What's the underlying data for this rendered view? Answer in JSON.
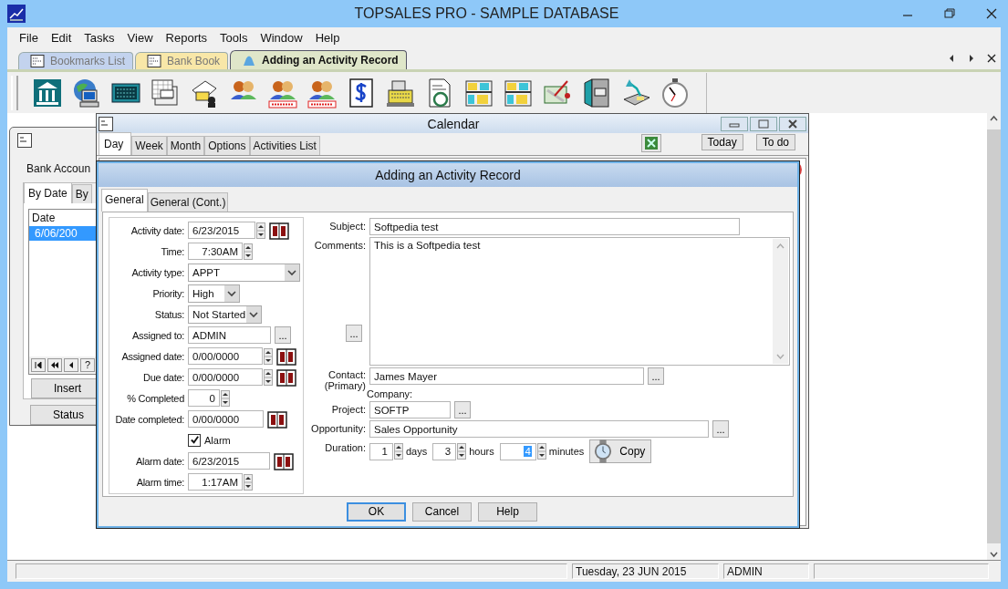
{
  "window": {
    "title": "TOPSALES PRO - SAMPLE DATABASE"
  },
  "menu": [
    "File",
    "Edit",
    "Tasks",
    "View",
    "Reports",
    "Tools",
    "Window",
    "Help"
  ],
  "document_tabs": [
    {
      "label": "Bookmarks List",
      "selected": false,
      "color": "#c3d3ee"
    },
    {
      "label": "Bank Book",
      "selected": false,
      "color": "#f8e7a8"
    },
    {
      "label": "Adding an Activity Record",
      "selected": true,
      "color": "#dfe6c9"
    }
  ],
  "bank_account_window": {
    "heading": "Bank Accoun",
    "tabs": [
      {
        "label": "By Date",
        "selected": true
      },
      {
        "label": "By",
        "selected": false
      }
    ],
    "list": {
      "column": "Date",
      "rows": [
        {
          "value": "6/06/200",
          "selected": true
        }
      ]
    },
    "nav_help": "?",
    "buttons": [
      "Insert",
      "Status"
    ]
  },
  "calendar_window": {
    "title": "Calendar",
    "tabs": [
      {
        "label": "Day",
        "selected": true
      },
      {
        "label": "Week",
        "selected": false
      },
      {
        "label": "Month",
        "selected": false
      },
      {
        "label": "Options",
        "selected": false
      },
      {
        "label": "Activities List",
        "selected": false
      }
    ],
    "buttons": [
      "Today",
      "To do"
    ]
  },
  "dialog": {
    "title": "Adding an Activity Record",
    "tabs": [
      {
        "label": "General",
        "selected": true
      },
      {
        "label": "General (Cont.)",
        "selected": false
      }
    ],
    "left_fields": [
      {
        "label": "Activity date:",
        "value": "6/23/2015",
        "kind": "date-spin"
      },
      {
        "label": "Time:",
        "value": "7:30AM",
        "kind": "spin"
      },
      {
        "label": "Activity type:",
        "value": "APPT",
        "kind": "combo"
      },
      {
        "label": "Priority:",
        "value": "High",
        "kind": "combo"
      },
      {
        "label": "Status:",
        "value": "Not Started",
        "kind": "combo"
      },
      {
        "label": "Assigned to:",
        "value": "ADMIN",
        "kind": "lookup",
        "button": "..."
      },
      {
        "label": "Assigned date:",
        "value": "0/00/0000",
        "kind": "date-spin"
      },
      {
        "label": "Due date:",
        "value": "0/00/0000",
        "kind": "date-spin"
      },
      {
        "label": "% Completed",
        "value": "0",
        "kind": "spin"
      },
      {
        "label": "Date completed:",
        "value": "0/00/0000",
        "kind": "date"
      },
      {
        "label": "Alarm",
        "kind": "checkbox",
        "checked": true
      },
      {
        "label": "Alarm date:",
        "value": "6/23/2015",
        "kind": "date"
      },
      {
        "label": "Alarm time:",
        "value": "1:17AM",
        "kind": "spin"
      }
    ],
    "subject": {
      "label": "Subject:",
      "value": "Softpedia test"
    },
    "comments": {
      "label": "Comments:",
      "value": "This is a Softpedia test",
      "button": "..."
    },
    "contact": {
      "label": "Contact:",
      "sublabel": "(Primary)",
      "value": "James Mayer",
      "button": "..."
    },
    "company": {
      "label": "Company:"
    },
    "project": {
      "label": "Project:",
      "value": "SOFTP",
      "button": "..."
    },
    "opportunity": {
      "label": "Opportunity:",
      "value": "Sales Opportunity",
      "button": "..."
    },
    "duration": {
      "label": "Duration:",
      "parts": [
        {
          "value": "1",
          "unit": "days",
          "selected": false
        },
        {
          "value": "3",
          "unit": "hours",
          "selected": false
        },
        {
          "value": "4",
          "unit": "minutes",
          "selected": true
        }
      ]
    },
    "copy_button": "Copy",
    "buttons": [
      {
        "label": "OK",
        "default": true
      },
      {
        "label": "Cancel",
        "default": false
      },
      {
        "label": "Help",
        "default": false
      }
    ]
  },
  "status_bar": {
    "date": "Tuesday, 23 JUN 2015",
    "user": "ADMIN"
  }
}
